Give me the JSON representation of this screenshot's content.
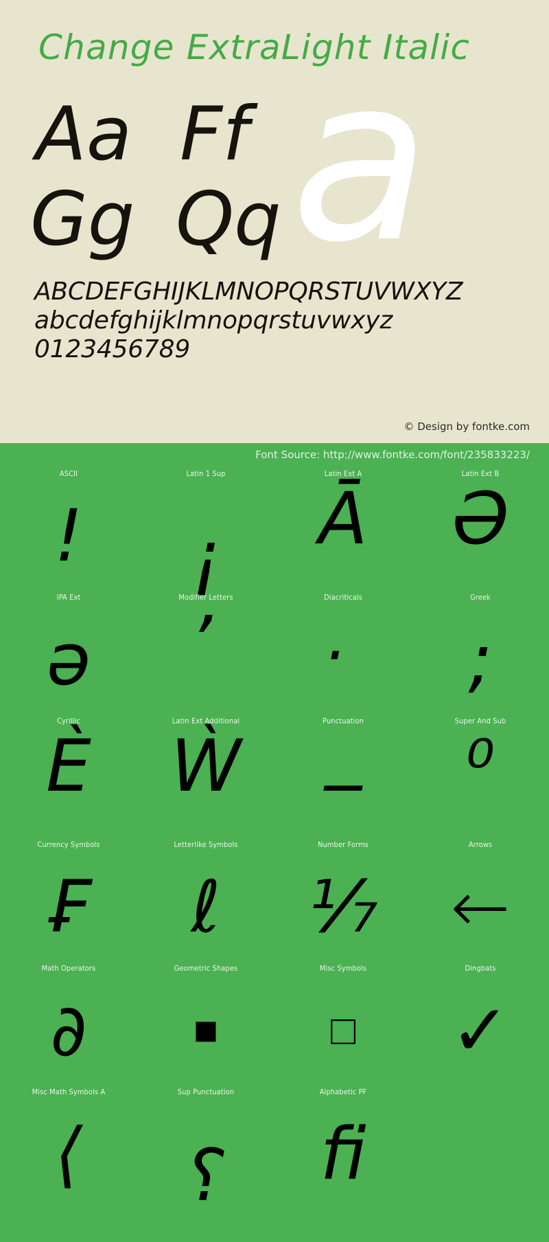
{
  "specimen": {
    "title": "Change ExtraLight Italic",
    "samples": [
      {
        "name": "pair-aa",
        "text": "Aa"
      },
      {
        "name": "pair-ff",
        "text": "Ff"
      },
      {
        "name": "pair-gg",
        "text": "Gg"
      },
      {
        "name": "pair-qq",
        "text": "Qq"
      }
    ],
    "watermark_glyph": "a",
    "alphabet_uppercase": "ABCDEFGHIJKLMNOPQRSTUVWXYZ",
    "alphabet_lowercase": "abcdefghijklmnopqrstuvwxyz",
    "digits": "0123456789",
    "copyright": "© Design by fontke.com"
  },
  "table": {
    "font_source": "Font Source: http://www.fontke.com/font/235833223/",
    "rows": [
      [
        {
          "label": "ASCII",
          "glyph": "!"
        },
        {
          "label": "Latin 1 Sup",
          "glyph": "¡"
        },
        {
          "label": "Latin Ext A",
          "glyph": "Ā"
        },
        {
          "label": "Latin Ext B",
          "glyph": "Ə"
        }
      ],
      [
        {
          "label": "IPA Ext",
          "glyph": "ə"
        },
        {
          "label": "Modifier Letters",
          "glyph": "ʼ"
        },
        {
          "label": "Diacriticals",
          "glyph": "̇"
        },
        {
          "label": "Greek",
          "glyph": ";"
        }
      ],
      [
        {
          "label": "Cyrillic",
          "glyph": "Ѐ"
        },
        {
          "label": "Latin Ext Additional",
          "glyph": "Ẁ"
        },
        {
          "label": "Punctuation",
          "glyph": "‒"
        },
        {
          "label": "Super And Sub",
          "glyph": "⁰"
        }
      ],
      [
        {
          "label": "Currency Symbols",
          "glyph": "₣"
        },
        {
          "label": "Letterlike Symbols",
          "glyph": "ℓ"
        },
        {
          "label": "Number Forms",
          "glyph": "⅐"
        },
        {
          "label": "Arrows",
          "glyph": "←"
        }
      ],
      [
        {
          "label": "Math Operators",
          "glyph": "∂"
        },
        {
          "label": "Geometric Shapes",
          "glyph": "■"
        },
        {
          "label": "Misc Symbols",
          "glyph": "□"
        },
        {
          "label": "Dingbats",
          "glyph": "✓"
        }
      ],
      [
        {
          "label": "Misc Math Symbols A",
          "glyph": "⟨"
        },
        {
          "label": "Sup Punctuation",
          "glyph": "⸮"
        },
        {
          "label": "Alphabetic PF",
          "glyph": "ﬁ"
        },
        {
          "label": "",
          "glyph": ""
        }
      ]
    ]
  },
  "colors": {
    "panel_background": "#e8e5ce",
    "table_background": "#4bb152",
    "title_green": "#43ab47",
    "glyph_black": "#000000",
    "watermark_white": "#ffffff",
    "label_text": "#ebf6ec"
  }
}
